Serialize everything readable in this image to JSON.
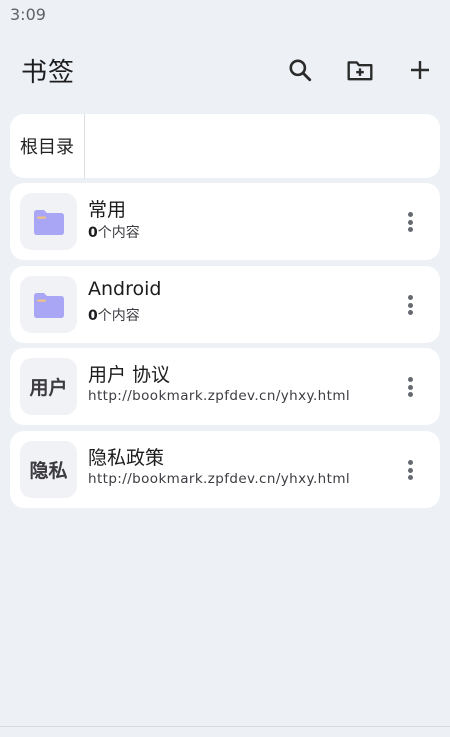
{
  "status_bar": {
    "time": "3:09"
  },
  "app_bar": {
    "title": "书签",
    "actions": [
      "search-icon",
      "new-folder-icon",
      "add-icon"
    ]
  },
  "breadcrumb": {
    "root": "根目录"
  },
  "items": [
    {
      "type": "folder",
      "title": "常用",
      "count": "0",
      "count_suffix": "个内容",
      "icon": "folder-icon"
    },
    {
      "type": "folder",
      "title": "Android",
      "count": "0",
      "count_suffix": "个内容",
      "icon": "folder-icon"
    },
    {
      "type": "bookmark",
      "thumb": "用户",
      "title": "用户 协议",
      "url": "http://bookmark.zpfdev.cn/yhxy.html"
    },
    {
      "type": "bookmark",
      "thumb": "隐私",
      "title": "隐私政策",
      "url": "http://bookmark.zpfdev.cn/yhxy.html"
    }
  ],
  "colors": {
    "background": "#edf0f4",
    "card": "#ffffff",
    "folder_accent": "#a9a6f5",
    "folder_tab": "#f0c08a"
  }
}
